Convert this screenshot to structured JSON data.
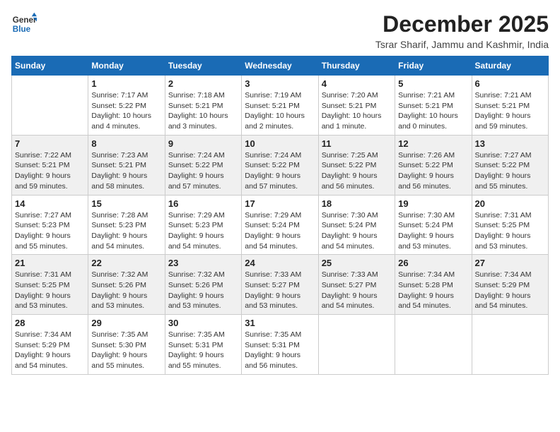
{
  "logo": {
    "line1": "General",
    "line2": "Blue"
  },
  "title": "December 2025",
  "location": "Tsrar Sharif, Jammu and Kashmir, India",
  "weekdays": [
    "Sunday",
    "Monday",
    "Tuesday",
    "Wednesday",
    "Thursday",
    "Friday",
    "Saturday"
  ],
  "weeks": [
    [
      {
        "day": "",
        "info": ""
      },
      {
        "day": "1",
        "info": "Sunrise: 7:17 AM\nSunset: 5:22 PM\nDaylight: 10 hours\nand 4 minutes."
      },
      {
        "day": "2",
        "info": "Sunrise: 7:18 AM\nSunset: 5:21 PM\nDaylight: 10 hours\nand 3 minutes."
      },
      {
        "day": "3",
        "info": "Sunrise: 7:19 AM\nSunset: 5:21 PM\nDaylight: 10 hours\nand 2 minutes."
      },
      {
        "day": "4",
        "info": "Sunrise: 7:20 AM\nSunset: 5:21 PM\nDaylight: 10 hours\nand 1 minute."
      },
      {
        "day": "5",
        "info": "Sunrise: 7:21 AM\nSunset: 5:21 PM\nDaylight: 10 hours\nand 0 minutes."
      },
      {
        "day": "6",
        "info": "Sunrise: 7:21 AM\nSunset: 5:21 PM\nDaylight: 9 hours\nand 59 minutes."
      }
    ],
    [
      {
        "day": "7",
        "info": "Sunrise: 7:22 AM\nSunset: 5:21 PM\nDaylight: 9 hours\nand 59 minutes."
      },
      {
        "day": "8",
        "info": "Sunrise: 7:23 AM\nSunset: 5:21 PM\nDaylight: 9 hours\nand 58 minutes."
      },
      {
        "day": "9",
        "info": "Sunrise: 7:24 AM\nSunset: 5:22 PM\nDaylight: 9 hours\nand 57 minutes."
      },
      {
        "day": "10",
        "info": "Sunrise: 7:24 AM\nSunset: 5:22 PM\nDaylight: 9 hours\nand 57 minutes."
      },
      {
        "day": "11",
        "info": "Sunrise: 7:25 AM\nSunset: 5:22 PM\nDaylight: 9 hours\nand 56 minutes."
      },
      {
        "day": "12",
        "info": "Sunrise: 7:26 AM\nSunset: 5:22 PM\nDaylight: 9 hours\nand 56 minutes."
      },
      {
        "day": "13",
        "info": "Sunrise: 7:27 AM\nSunset: 5:22 PM\nDaylight: 9 hours\nand 55 minutes."
      }
    ],
    [
      {
        "day": "14",
        "info": "Sunrise: 7:27 AM\nSunset: 5:23 PM\nDaylight: 9 hours\nand 55 minutes."
      },
      {
        "day": "15",
        "info": "Sunrise: 7:28 AM\nSunset: 5:23 PM\nDaylight: 9 hours\nand 54 minutes."
      },
      {
        "day": "16",
        "info": "Sunrise: 7:29 AM\nSunset: 5:23 PM\nDaylight: 9 hours\nand 54 minutes."
      },
      {
        "day": "17",
        "info": "Sunrise: 7:29 AM\nSunset: 5:24 PM\nDaylight: 9 hours\nand 54 minutes."
      },
      {
        "day": "18",
        "info": "Sunrise: 7:30 AM\nSunset: 5:24 PM\nDaylight: 9 hours\nand 54 minutes."
      },
      {
        "day": "19",
        "info": "Sunrise: 7:30 AM\nSunset: 5:24 PM\nDaylight: 9 hours\nand 53 minutes."
      },
      {
        "day": "20",
        "info": "Sunrise: 7:31 AM\nSunset: 5:25 PM\nDaylight: 9 hours\nand 53 minutes."
      }
    ],
    [
      {
        "day": "21",
        "info": "Sunrise: 7:31 AM\nSunset: 5:25 PM\nDaylight: 9 hours\nand 53 minutes."
      },
      {
        "day": "22",
        "info": "Sunrise: 7:32 AM\nSunset: 5:26 PM\nDaylight: 9 hours\nand 53 minutes."
      },
      {
        "day": "23",
        "info": "Sunrise: 7:32 AM\nSunset: 5:26 PM\nDaylight: 9 hours\nand 53 minutes."
      },
      {
        "day": "24",
        "info": "Sunrise: 7:33 AM\nSunset: 5:27 PM\nDaylight: 9 hours\nand 53 minutes."
      },
      {
        "day": "25",
        "info": "Sunrise: 7:33 AM\nSunset: 5:27 PM\nDaylight: 9 hours\nand 54 minutes."
      },
      {
        "day": "26",
        "info": "Sunrise: 7:34 AM\nSunset: 5:28 PM\nDaylight: 9 hours\nand 54 minutes."
      },
      {
        "day": "27",
        "info": "Sunrise: 7:34 AM\nSunset: 5:29 PM\nDaylight: 9 hours\nand 54 minutes."
      }
    ],
    [
      {
        "day": "28",
        "info": "Sunrise: 7:34 AM\nSunset: 5:29 PM\nDaylight: 9 hours\nand 54 minutes."
      },
      {
        "day": "29",
        "info": "Sunrise: 7:35 AM\nSunset: 5:30 PM\nDaylight: 9 hours\nand 55 minutes."
      },
      {
        "day": "30",
        "info": "Sunrise: 7:35 AM\nSunset: 5:31 PM\nDaylight: 9 hours\nand 55 minutes."
      },
      {
        "day": "31",
        "info": "Sunrise: 7:35 AM\nSunset: 5:31 PM\nDaylight: 9 hours\nand 56 minutes."
      },
      {
        "day": "",
        "info": ""
      },
      {
        "day": "",
        "info": ""
      },
      {
        "day": "",
        "info": ""
      }
    ]
  ]
}
